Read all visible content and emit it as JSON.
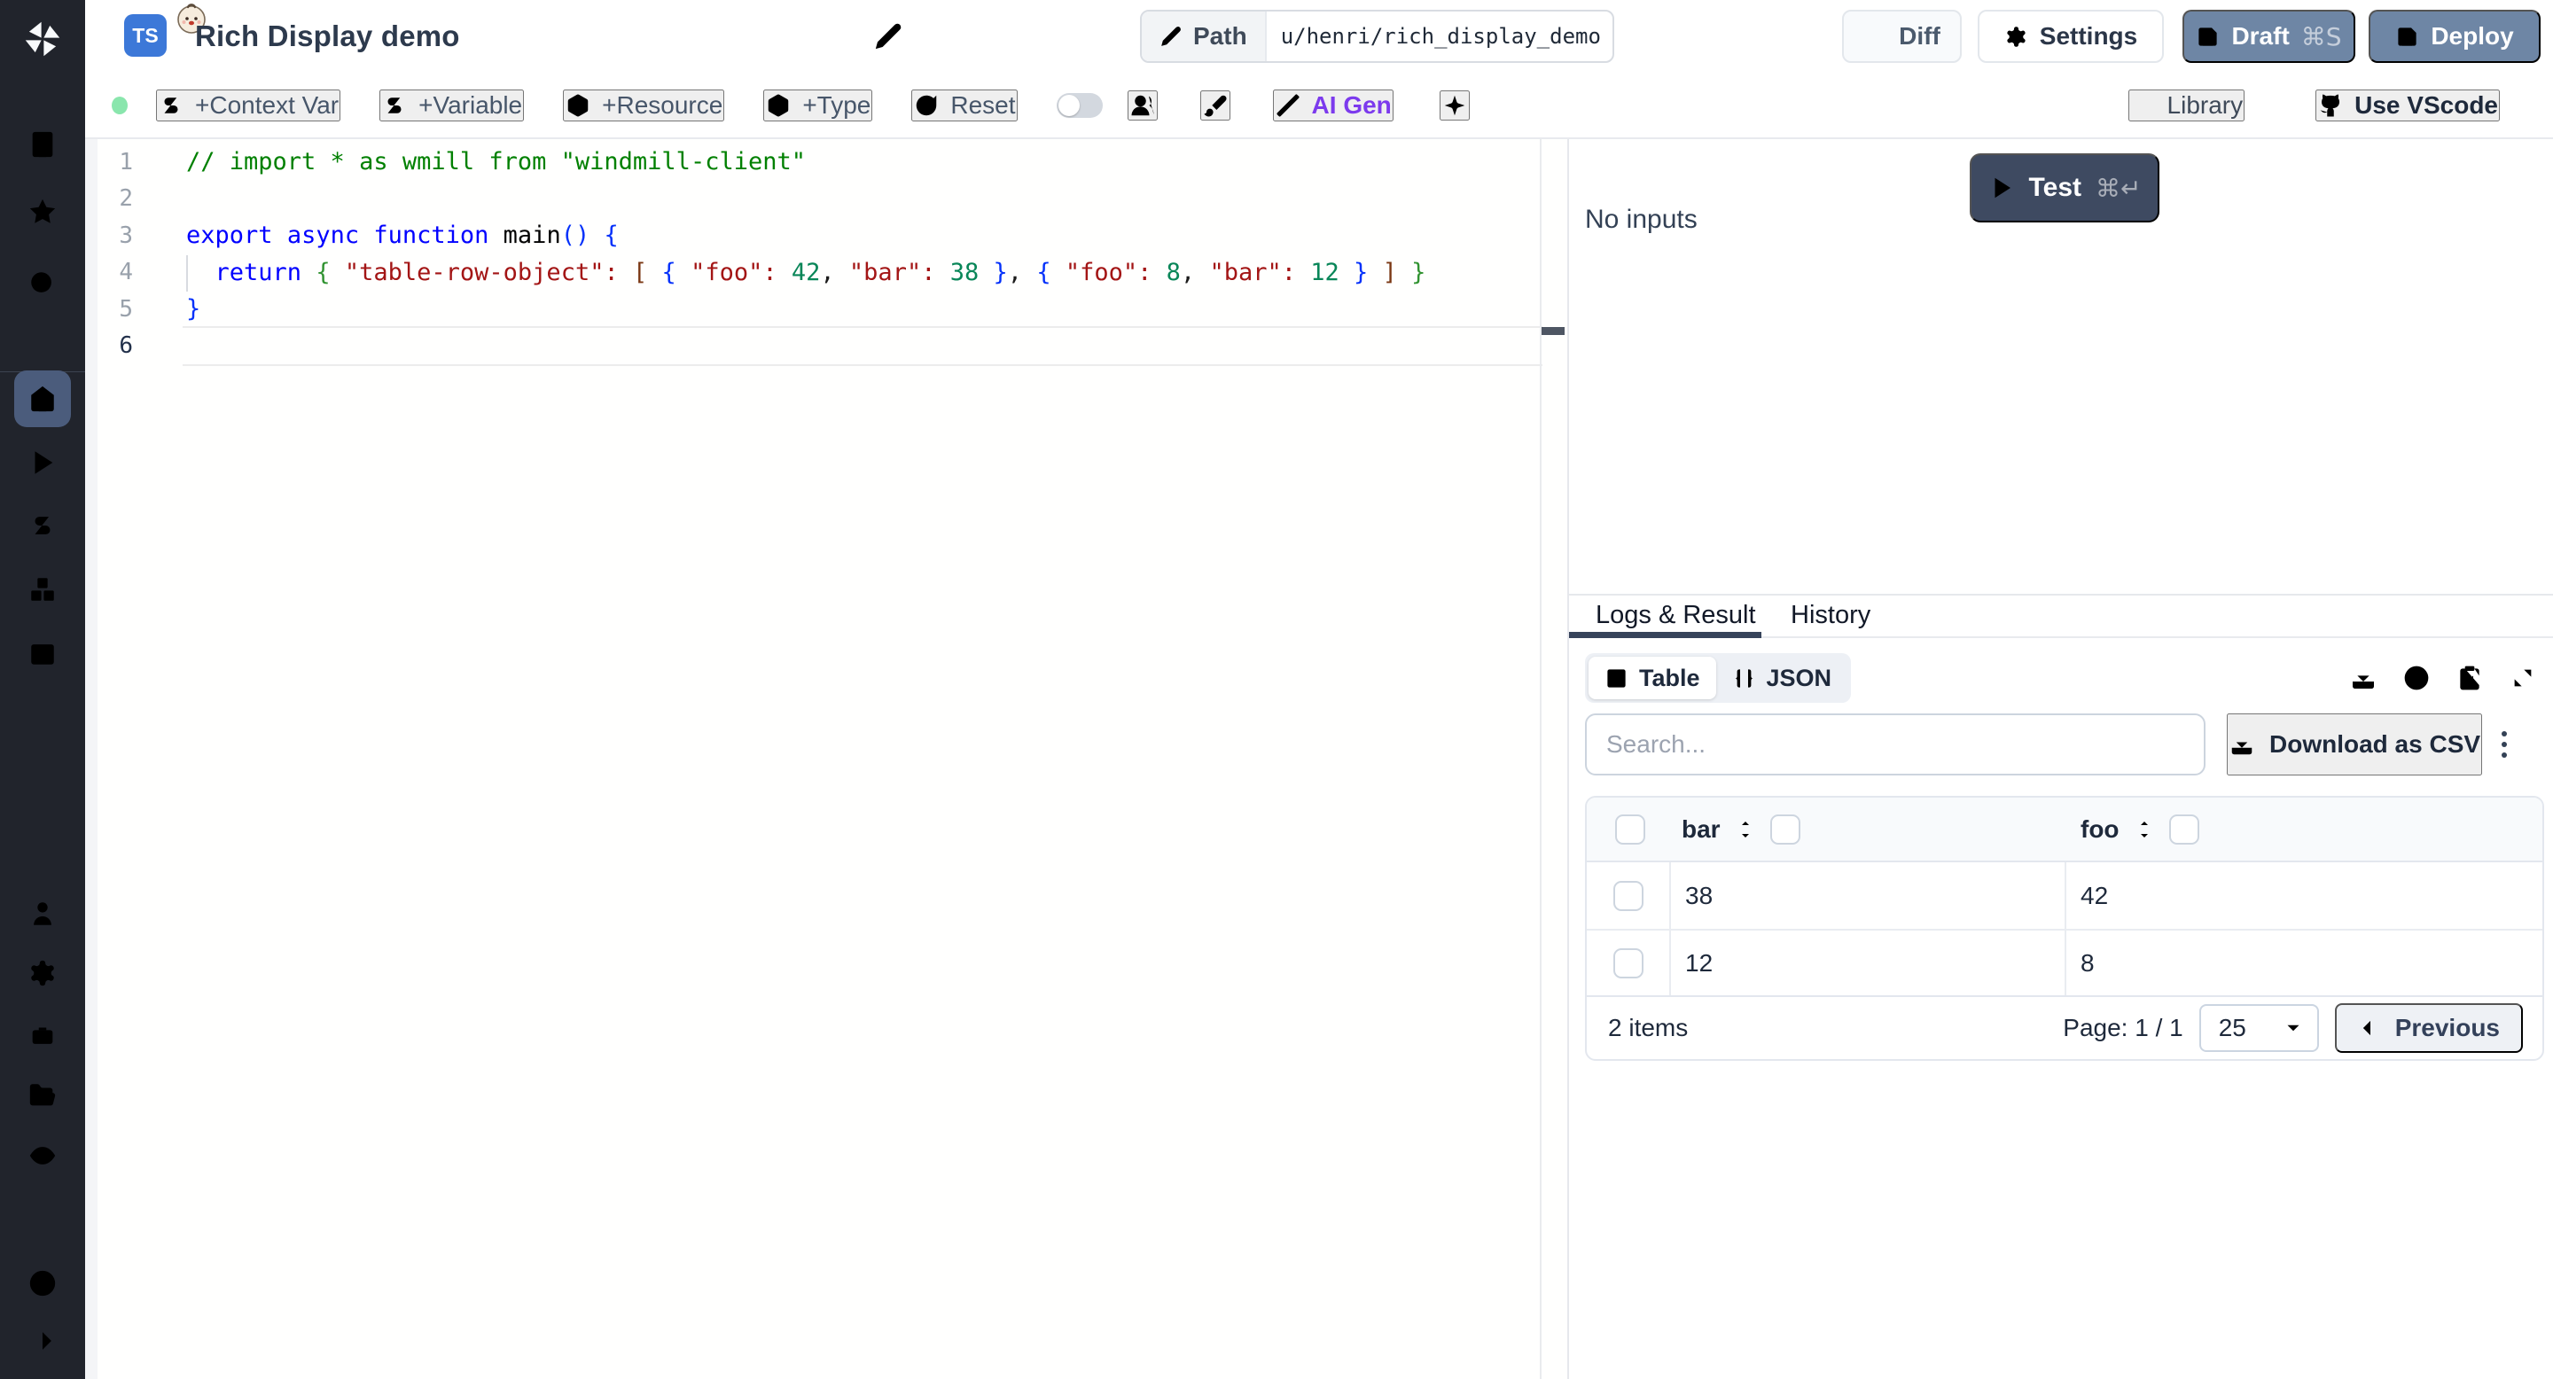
{
  "header": {
    "lang_badge": "TS",
    "title": "Rich Display demo",
    "path_label": "Path",
    "path_value": "u/henri/rich_display_demo",
    "diff": "Diff",
    "settings": "Settings",
    "draft": "Draft",
    "draft_shortcut": "⌘S",
    "deploy": "Deploy"
  },
  "toolbar": {
    "context_var": "+Context Var",
    "variable": "+Variable",
    "resource": "+Resource",
    "type": "+Type",
    "reset": "Reset",
    "ai_gen": "AI Gen",
    "library": "Library",
    "use_vscode": "Use VScode"
  },
  "sidebar": {
    "icons": [
      "windmill-logo",
      "building",
      "star",
      "search",
      "home",
      "play",
      "dollar",
      "blocks",
      "calendar",
      "user",
      "settings",
      "bot",
      "folder-open",
      "eye",
      "help",
      "arrow-right"
    ]
  },
  "editor": {
    "lines": [
      {
        "number": "1",
        "active": false,
        "tokens": [
          {
            "text": "// import * as wmill from \"windmill-client\"",
            "type": "comment"
          }
        ]
      },
      {
        "number": "2",
        "active": false,
        "tokens": []
      },
      {
        "number": "3",
        "active": false,
        "tokens": [
          {
            "text": "export",
            "type": "keyword"
          },
          {
            "text": " ",
            "type": "plain"
          },
          {
            "text": "async",
            "type": "keyword"
          },
          {
            "text": " ",
            "type": "plain"
          },
          {
            "text": "function",
            "type": "keyword"
          },
          {
            "text": " ",
            "type": "plain"
          },
          {
            "text": "main",
            "type": "function"
          },
          {
            "text": "(",
            "type": "bracket1"
          },
          {
            "text": ")",
            "type": "bracket1"
          },
          {
            "text": " ",
            "type": "plain"
          },
          {
            "text": "{",
            "type": "bracket1"
          }
        ]
      },
      {
        "number": "4",
        "active": false,
        "tokens": [
          {
            "text": "  ",
            "type": "plain"
          },
          {
            "text": "return",
            "type": "keyword"
          },
          {
            "text": " ",
            "type": "plain"
          },
          {
            "text": "{",
            "type": "bracket2"
          },
          {
            "text": " ",
            "type": "plain"
          },
          {
            "text": "\"table-row-object\"",
            "type": "string"
          },
          {
            "text": ":",
            "type": "colon"
          },
          {
            "text": " ",
            "type": "plain"
          },
          {
            "text": "[",
            "type": "bracket3"
          },
          {
            "text": " ",
            "type": "plain"
          },
          {
            "text": "{",
            "type": "bracket1"
          },
          {
            "text": " ",
            "type": "plain"
          },
          {
            "text": "\"foo\"",
            "type": "string"
          },
          {
            "text": ":",
            "type": "colon"
          },
          {
            "text": " ",
            "type": "plain"
          },
          {
            "text": "42",
            "type": "number"
          },
          {
            "text": ",",
            "type": "plain"
          },
          {
            "text": " ",
            "type": "plain"
          },
          {
            "text": "\"bar\"",
            "type": "string"
          },
          {
            "text": ":",
            "type": "colon"
          },
          {
            "text": " ",
            "type": "plain"
          },
          {
            "text": "38",
            "type": "number"
          },
          {
            "text": " ",
            "type": "plain"
          },
          {
            "text": "}",
            "type": "bracket1"
          },
          {
            "text": ",",
            "type": "plain"
          },
          {
            "text": " ",
            "type": "plain"
          },
          {
            "text": "{",
            "type": "bracket1"
          },
          {
            "text": " ",
            "type": "plain"
          },
          {
            "text": "\"foo\"",
            "type": "string"
          },
          {
            "text": ":",
            "type": "colon"
          },
          {
            "text": " ",
            "type": "plain"
          },
          {
            "text": "8",
            "type": "number"
          },
          {
            "text": ",",
            "type": "plain"
          },
          {
            "text": " ",
            "type": "plain"
          },
          {
            "text": "\"bar\"",
            "type": "string"
          },
          {
            "text": ":",
            "type": "colon"
          },
          {
            "text": " ",
            "type": "plain"
          },
          {
            "text": "12",
            "type": "number"
          },
          {
            "text": " ",
            "type": "plain"
          },
          {
            "text": "}",
            "type": "bracket1"
          },
          {
            "text": " ",
            "type": "plain"
          },
          {
            "text": "]",
            "type": "bracket3"
          },
          {
            "text": " ",
            "type": "plain"
          },
          {
            "text": "}",
            "type": "bracket2"
          }
        ]
      },
      {
        "number": "5",
        "active": false,
        "tokens": [
          {
            "text": "}",
            "type": "bracket1"
          }
        ]
      },
      {
        "number": "6",
        "active": true,
        "tokens": []
      }
    ]
  },
  "run": {
    "test": "Test",
    "test_shortcut": "⌘↵",
    "no_inputs": "No inputs"
  },
  "result": {
    "tab_logs": "Logs & Result",
    "tab_history": "History",
    "view_table": "Table",
    "view_json": "JSON",
    "search_placeholder": "Search...",
    "download_csv": "Download as CSV",
    "table": {
      "col_bar": "bar",
      "col_foo": "foo",
      "rows": [
        {
          "bar": "38",
          "foo": "42"
        },
        {
          "bar": "12",
          "foo": "8"
        }
      ]
    },
    "footer": {
      "items_count": "2 items",
      "page": "Page: 1 / 1",
      "page_size": "25",
      "previous": "Previous"
    }
  },
  "colors": {
    "accent_purple": "#7c3aed",
    "header_button_slate": "#6e86a5",
    "test_button_navy": "#3e4a61",
    "status_green": "#8ae6ad",
    "table_icon_blue": "#3b82f6"
  }
}
